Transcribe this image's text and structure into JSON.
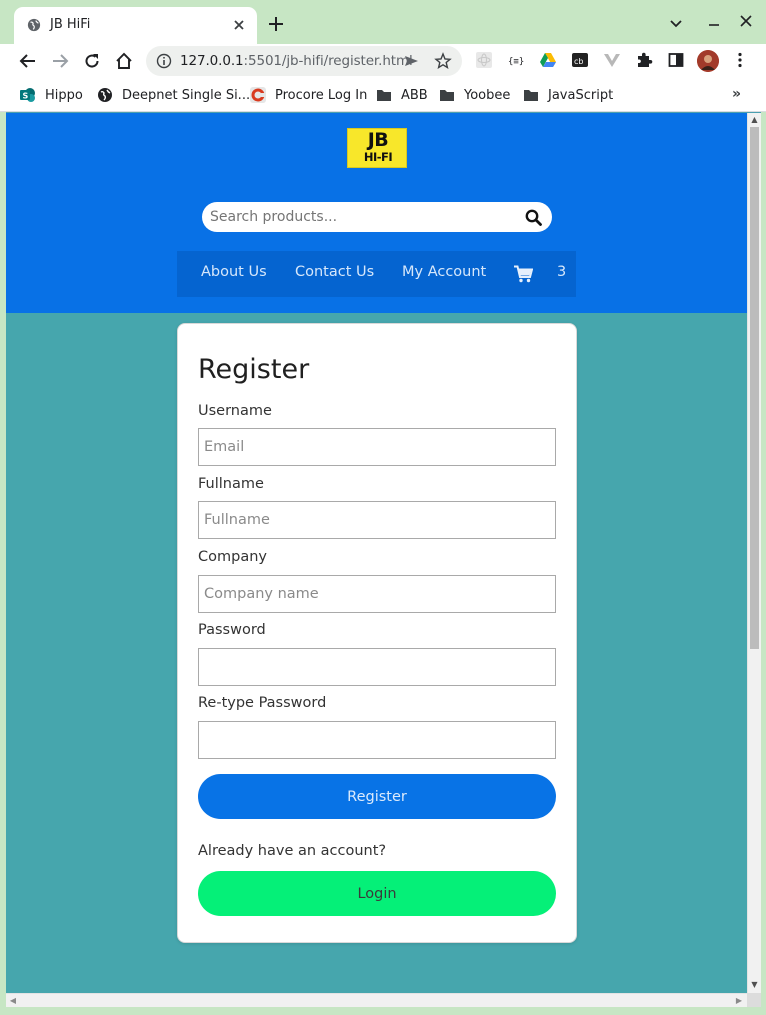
{
  "browser": {
    "tab_title": "JB HiFi",
    "url_host": "127.0.0.1",
    "url_rest": ":5501/jb-hifi/register.html",
    "bookmarks": [
      {
        "label": "Hippo",
        "icon": "sharepoint-icon"
      },
      {
        "label": "Deepnet Single Si...",
        "icon": "globe-icon"
      },
      {
        "label": "Procore Log In",
        "icon": "procore-icon"
      },
      {
        "label": "ABB",
        "icon": "folder-icon"
      },
      {
        "label": "Yoobee",
        "icon": "folder-icon"
      },
      {
        "label": "JavaScript",
        "icon": "folder-icon"
      }
    ],
    "bookmarks_more": "»"
  },
  "header": {
    "logo_top": "JB",
    "logo_bottom": "HI-FI",
    "search_placeholder": "Search products...",
    "nav": [
      "About Us",
      "Contact Us",
      "My Account"
    ],
    "cart_count": "3"
  },
  "register": {
    "title": "Register",
    "fields": [
      {
        "label": "Username",
        "placeholder": "Email"
      },
      {
        "label": "Fullname",
        "placeholder": "Fullname"
      },
      {
        "label": "Company",
        "placeholder": "Company name"
      },
      {
        "label": "Password",
        "placeholder": ""
      },
      {
        "label": "Re-type Password",
        "placeholder": ""
      }
    ],
    "register_button": "Register",
    "already_text": "Already have an account?",
    "login_button": "Login"
  },
  "colors": {
    "header_blue": "#0871e6",
    "nav_blue": "#0564d0",
    "page_teal": "#46a6ad",
    "register_button": "#0873e6",
    "login_button": "#05f078",
    "browser_frame": "#c7e6c4"
  }
}
